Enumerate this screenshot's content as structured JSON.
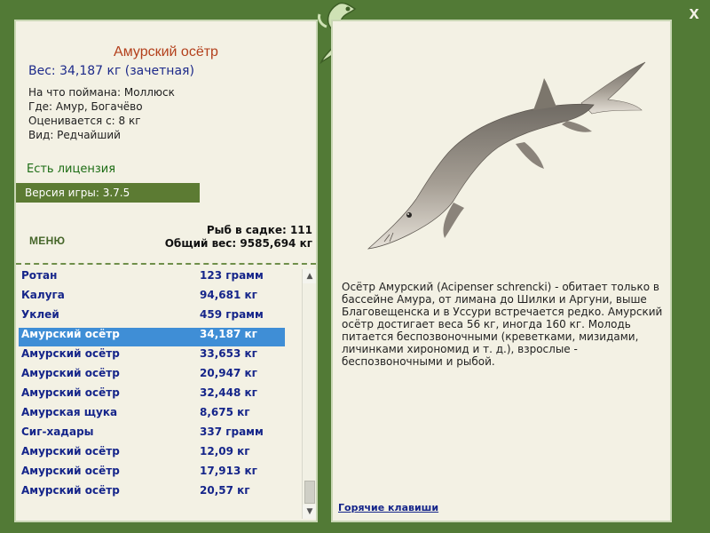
{
  "close_label": "x",
  "fish": {
    "name": "Амурский осётр",
    "weight": "Вес: 34,187 кг (зачетная)",
    "caught_on": "На что поймана: Моллюск",
    "where": "Где: Амур, Богачёво",
    "rated_from": "Оценивается с: 8 кг",
    "kind": "Вид: Редчайший",
    "license": "Есть лицензия",
    "description": "Осётр Амурский (Acipenser schrencki) - обитает только в бассейне Амура, от лимана до Шилки и Аргуни, выше Благовещенска и в Уссури встречается редко. Амурский осётр достигает веса 56 кг, иногда 160 кг. Молодь питается беспозвоночными (креветками, мизидами, личинками хирономид и т. д.), взрослые - беспозвоночными и рыбой."
  },
  "version": "Версия игры: 3.7.5",
  "menu_label": "МЕНЮ",
  "stats": {
    "in_cage": "Рыб в садке: 111",
    "total_weight": "Общий вес: 9585,694 кг"
  },
  "catch_list": [
    {
      "name": "Ротан",
      "weight": "123 грамм"
    },
    {
      "name": "Калуга",
      "weight": "94,681 кг"
    },
    {
      "name": "Уклей",
      "weight": "459 грамм"
    },
    {
      "name": "Амурский осётр",
      "weight": "34,187 кг"
    },
    {
      "name": "Амурский осётр",
      "weight": "33,653 кг"
    },
    {
      "name": "Амурский осётр",
      "weight": "20,947 кг"
    },
    {
      "name": "Амурский осётр",
      "weight": "32,448 кг"
    },
    {
      "name": "Амурская щука",
      "weight": "8,675 кг"
    },
    {
      "name": "Сиг-хадары",
      "weight": "337 грамм"
    },
    {
      "name": "Амурский осётр",
      "weight": "12,09 кг"
    },
    {
      "name": "Амурский осётр",
      "weight": "17,913 кг"
    },
    {
      "name": "Амурский осётр",
      "weight": "20,57 кг"
    }
  ],
  "selected_index": 3,
  "hotkeys_label": "Горячие клавиши",
  "colors": {
    "frame": "#527a36",
    "panel": "#f3f1e4",
    "selection": "#3f8ed6",
    "list_text": "#15258a",
    "title": "#b3401c"
  }
}
